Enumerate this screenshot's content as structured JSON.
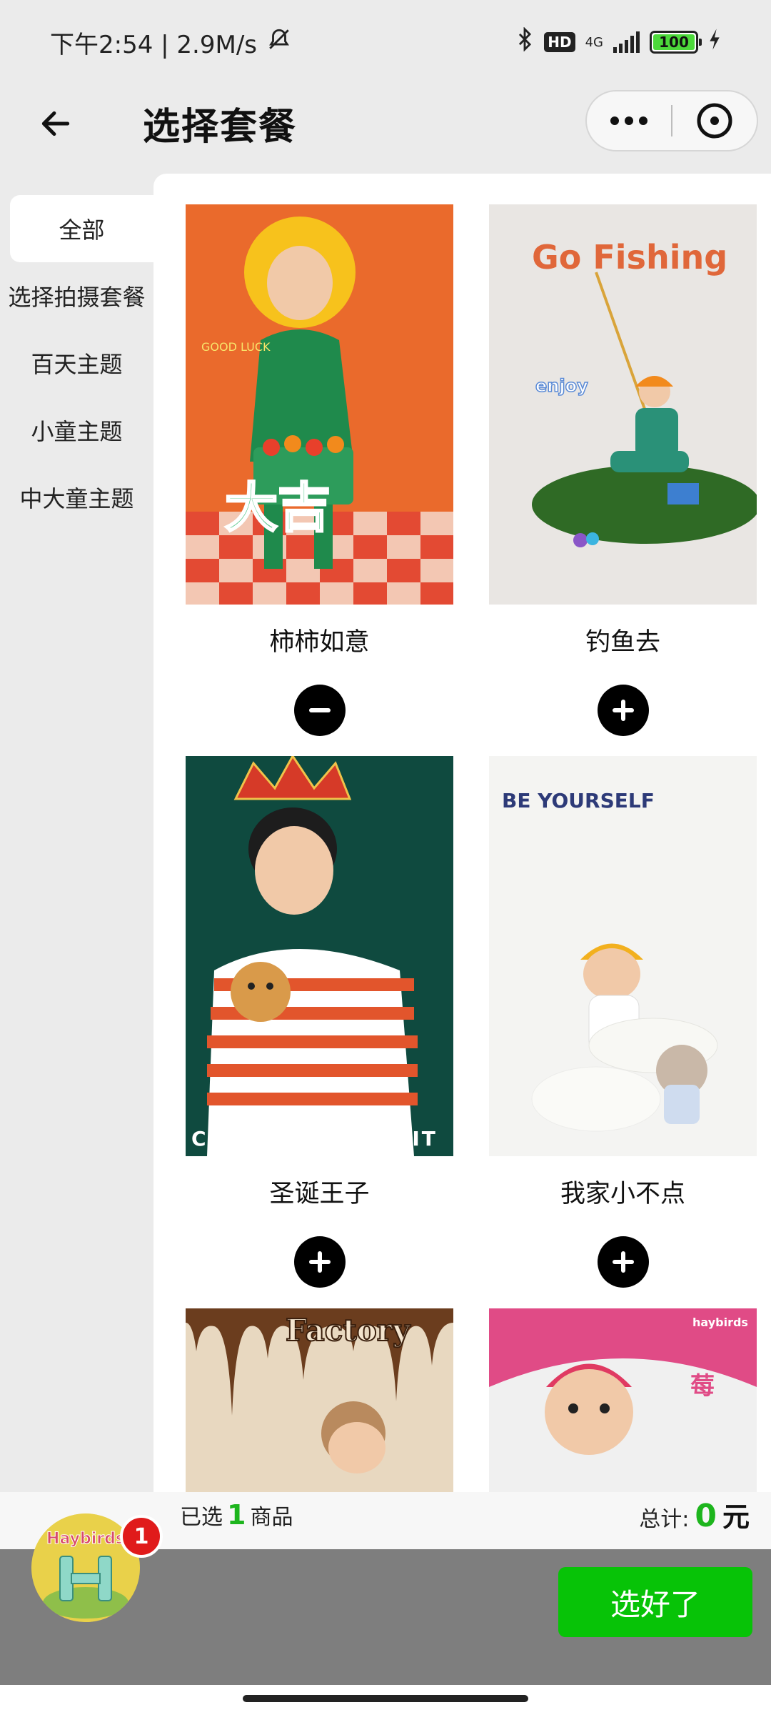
{
  "status_bar": {
    "time": "下午2:54 | 2.9M/s",
    "network_type": "4G",
    "hd_label": "HD",
    "battery_level": "100"
  },
  "header": {
    "title": "选择套餐"
  },
  "sidebar": {
    "items": [
      {
        "label": "全部",
        "active": true
      },
      {
        "label": "选择拍摄套餐",
        "active": false
      },
      {
        "label": "百天主题",
        "active": false
      },
      {
        "label": "小童主题",
        "active": false
      },
      {
        "label": "中大童主题",
        "active": false
      }
    ]
  },
  "products": [
    {
      "name": "柿柿如意",
      "selected": true,
      "photo_text": [
        "大吉",
        "GOOD LUCK"
      ],
      "colors": {
        "bg": "#ea6a2c",
        "accent": "#1f8a4c"
      }
    },
    {
      "name": "钓鱼去",
      "selected": false,
      "photo_text": [
        "Go Fishing",
        "enjoy"
      ],
      "colors": {
        "bg": "#e9e6e3",
        "accent": "#e0673a"
      }
    },
    {
      "name": "圣诞王子",
      "selected": false,
      "photo_text": [
        "CHRISTMAS SPIRIT"
      ],
      "colors": {
        "bg": "#0f4a3f",
        "accent": "#d63a28"
      }
    },
    {
      "name": "我家小不点",
      "selected": false,
      "photo_text": [
        "BE YOURSELF"
      ],
      "colors": {
        "bg": "#f4f4f2",
        "accent": "#f2b01e"
      }
    },
    {
      "name": "",
      "selected": false,
      "photo_text": [
        "Factory"
      ],
      "colors": {
        "bg": "#e8d8c0",
        "accent": "#6b3d1e"
      }
    },
    {
      "name": "",
      "selected": false,
      "photo_text": [
        "haybirds",
        "莓"
      ],
      "colors": {
        "bg": "#e04b86",
        "accent": "#f0f0f0"
      }
    }
  ],
  "summary": {
    "selected_prefix": "已选",
    "selected_count": "1",
    "selected_suffix": "商品",
    "total_label": "总计:",
    "total_amount": "0",
    "total_unit": "元"
  },
  "cart": {
    "logo_text": "Haybirds",
    "badge_count": "1"
  },
  "actions": {
    "confirm_label": "选好了"
  }
}
